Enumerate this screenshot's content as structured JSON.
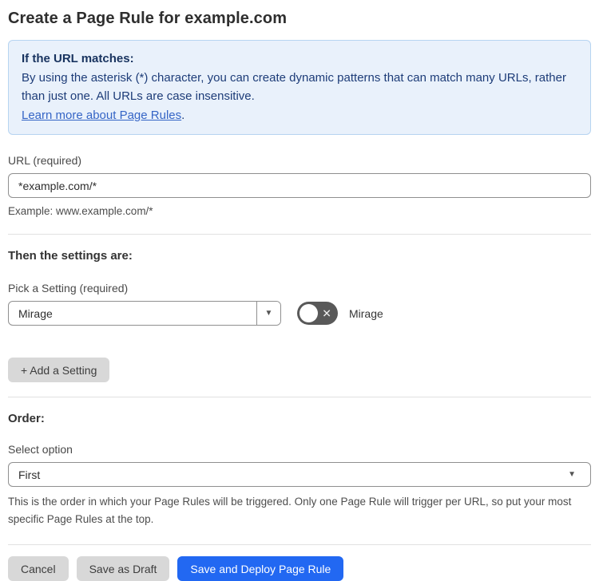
{
  "page": {
    "title": "Create a Page Rule for example.com"
  },
  "callout": {
    "heading": "If the URL matches:",
    "body": "By using the asterisk (*) character, you can create dynamic patterns that can match many URLs, rather than just one. All URLs are case insensitive.",
    "link_label": "Learn more about Page Rules",
    "link_suffix": "."
  },
  "url_field": {
    "label": "URL (required)",
    "value": "*example.com/*",
    "helper": "Example: www.example.com/*"
  },
  "settings_section": {
    "heading": "Then the settings are:",
    "pick_label": "Pick a Setting (required)",
    "selected_setting": "Mirage",
    "toggle_label": "Mirage",
    "toggle_state": "off",
    "add_button_label": "+ Add a Setting"
  },
  "order_section": {
    "heading": "Order:",
    "select_label": "Select option",
    "selected_option": "First",
    "helper": "This is the order in which your Page Rules will be triggered. Only one Page Rule will trigger per URL, so put your most specific Page Rules at the top."
  },
  "footer": {
    "cancel_label": "Cancel",
    "save_draft_label": "Save as Draft",
    "save_deploy_label": "Save and Deploy Page Rule"
  },
  "icons": {
    "caret_down": "▼",
    "x_mark": "✕"
  },
  "colors": {
    "accent_blue": "#2268f2",
    "callout_bg": "#e9f1fb",
    "callout_border": "#b7d4f1",
    "callout_text": "#1d3c78",
    "link_blue": "#3565c6",
    "toggle_off_bg": "#595959",
    "gray_button_bg": "#d8d8d8"
  }
}
